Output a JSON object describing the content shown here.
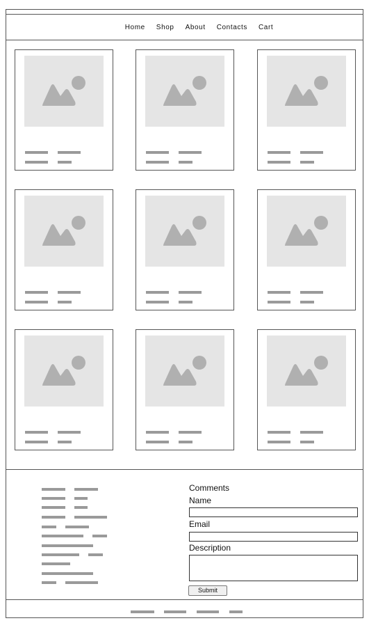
{
  "nav": {
    "items": [
      "Home",
      "Shop",
      "About",
      "Contacts",
      "Cart"
    ]
  },
  "products": {
    "count": 9
  },
  "form": {
    "title": "Comments",
    "name_label": "Name",
    "email_label": "Email",
    "description_label": "Description",
    "name_value": "",
    "email_value": "",
    "description_value": "",
    "submit_label": "Submit"
  },
  "colors": {
    "border": "#555555",
    "placeholder_bg": "#e5e5e5",
    "placeholder_shape": "#b0b0b0",
    "text_line": "#9a9a9a"
  },
  "icons": {
    "product_image": "image-placeholder-icon"
  }
}
